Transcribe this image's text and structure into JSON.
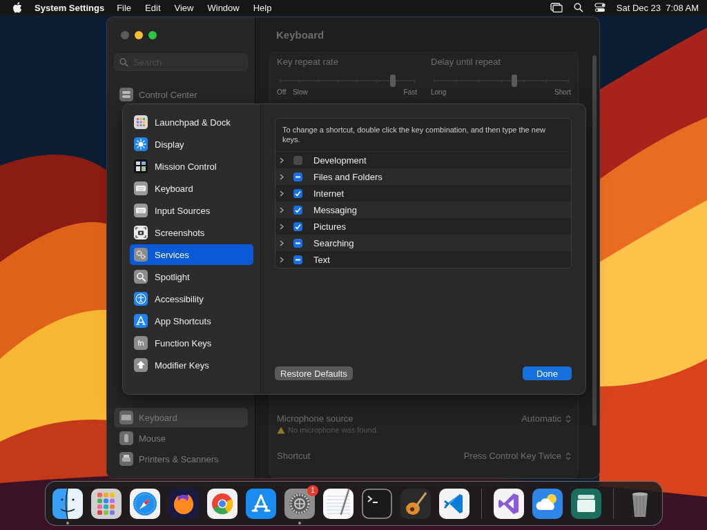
{
  "menu_bar": {
    "app_name": "System Settings",
    "menus": [
      "File",
      "Edit",
      "View",
      "Window",
      "Help"
    ],
    "clock": "Sat Dec 23  7:08 AM"
  },
  "window": {
    "title": "Keyboard",
    "search": {
      "placeholder": "Search"
    },
    "sidebar": {
      "items": [
        {
          "label": "Control Center",
          "selected": false
        },
        {
          "label": "Keyboard",
          "selected": true
        },
        {
          "label": "Mouse",
          "selected": false
        },
        {
          "label": "Printers & Scanners",
          "selected": false
        }
      ]
    },
    "sliders": [
      {
        "label": "Key repeat rate",
        "level": 0.84,
        "marks": [
          "Off",
          "Slow",
          "Fast"
        ]
      },
      {
        "label": "Delay until repeat",
        "level": 0.6,
        "marks": [
          "Long",
          "Short"
        ]
      }
    ],
    "dictation": [
      {
        "label": "Microphone source",
        "value": "Automatic",
        "warning": "No microphone was found."
      },
      {
        "label": "Shortcut",
        "value": "Press Control Key Twice"
      }
    ]
  },
  "sheet": {
    "categories": [
      {
        "label": "Launchpad & Dock",
        "selected": false
      },
      {
        "label": "Display",
        "selected": false
      },
      {
        "label": "Mission Control",
        "selected": false
      },
      {
        "label": "Keyboard",
        "selected": false
      },
      {
        "label": "Input Sources",
        "selected": false
      },
      {
        "label": "Screenshots",
        "selected": false
      },
      {
        "label": "Services",
        "selected": true
      },
      {
        "label": "Spotlight",
        "selected": false
      },
      {
        "label": "Accessibility",
        "selected": false
      },
      {
        "label": "App Shortcuts",
        "selected": false
      },
      {
        "label": "Function Keys",
        "selected": false,
        "glyph": "fn"
      },
      {
        "label": "Modifier Keys",
        "selected": false
      }
    ],
    "hint": "To change a shortcut, double click the key combination, and then type the new keys.",
    "services": [
      {
        "label": "Development",
        "checked": false,
        "mixed": false
      },
      {
        "label": "Files and Folders",
        "mixed": true
      },
      {
        "label": "Internet",
        "checked": true,
        "mixed": false
      },
      {
        "label": "Messaging",
        "checked": true,
        "mixed": false
      },
      {
        "label": "Pictures",
        "checked": true,
        "mixed": false
      },
      {
        "label": "Searching",
        "mixed": true
      },
      {
        "label": "Text",
        "mixed": true
      }
    ],
    "buttons": [
      {
        "label": "Restore Defaults",
        "kind": "secondary"
      },
      {
        "label": "Done",
        "kind": "primary"
      }
    ]
  },
  "dock": {
    "sections": [
      {
        "apps": [
          {
            "running": true
          },
          {
            "running": false
          },
          {
            "running": false
          },
          {
            "running": false
          },
          {
            "running": false
          },
          {
            "running": false
          },
          {
            "running": true,
            "badge": "1"
          },
          {
            "running": false
          },
          {
            "running": false
          },
          {
            "running": false
          },
          {
            "running": false
          }
        ]
      },
      {
        "apps": [
          {
            "running": false
          },
          {
            "running": false
          },
          {
            "running": false
          }
        ]
      },
      {
        "apps": [
          {
            "running": false
          }
        ]
      }
    ]
  }
}
